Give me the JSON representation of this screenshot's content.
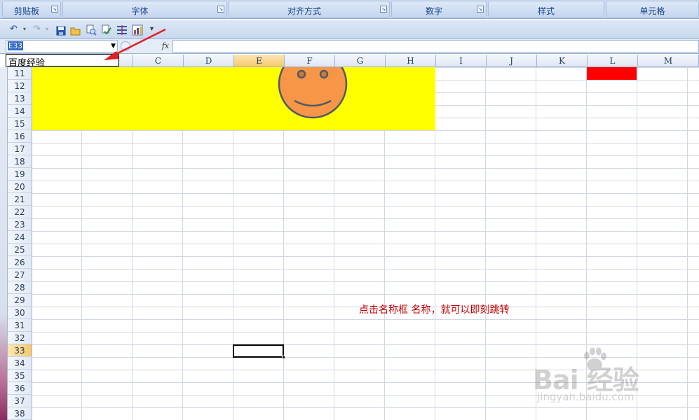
{
  "ribbon": {
    "groups": [
      "剪贴板",
      "字体",
      "对齐方式",
      "数字",
      "样式",
      "单元格"
    ],
    "launcher_glyph": "↘"
  },
  "quick_access": {
    "undo_icon": "undo-icon",
    "redo_icon": "redo-icon",
    "customize_glyph": "▾"
  },
  "formula_bar": {
    "name_box_value": "E33",
    "fx_label": "fx",
    "formula_value": ""
  },
  "name_list": {
    "item": "百度经验"
  },
  "columns": [
    "C",
    "D",
    "E",
    "F",
    "G",
    "H",
    "I",
    "J",
    "K",
    "L",
    "M"
  ],
  "selected_column": "E",
  "rows": [
    "11",
    "12",
    "13",
    "14",
    "15",
    "16",
    "17",
    "18",
    "19",
    "20",
    "21",
    "22",
    "23",
    "24",
    "25",
    "26",
    "27",
    "28",
    "29",
    "30",
    "31",
    "32",
    "33",
    "34",
    "35",
    "36",
    "37",
    "38"
  ],
  "selected_row": "33",
  "annotation": "点击名称框 名称，就可以即刻跳转",
  "watermark": {
    "main": "Bai 经验",
    "sub": "jingyan.baidu.com"
  },
  "colors": {
    "yellow_fill": "#ffff00",
    "red_fill": "#ff0000",
    "smiley_fill": "#f79646",
    "annotation": "#c00000",
    "arrow": "#e02020"
  }
}
